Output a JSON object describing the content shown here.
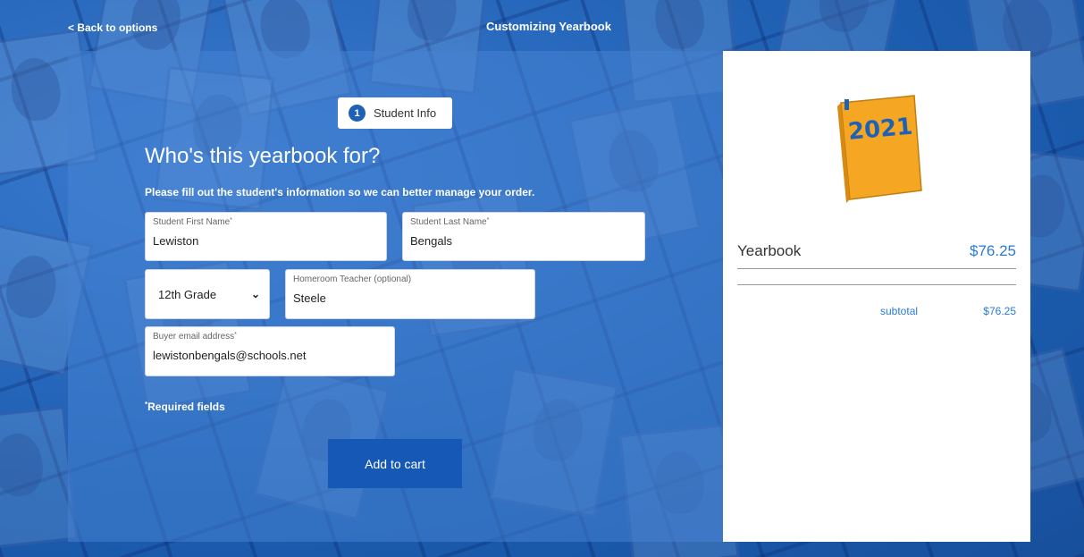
{
  "header": {
    "back_label": "< Back to options",
    "title": "Customizing Yearbook"
  },
  "form": {
    "step_number": "1",
    "step_label": "Student Info",
    "heading": "Who's this yearbook for?",
    "subtext": "Please fill out the student's information so we can better manage your order.",
    "first_name": {
      "label": "Student First Name",
      "value": "Lewiston"
    },
    "last_name": {
      "label": "Student Last Name",
      "value": "Bengals"
    },
    "grade": {
      "value": "12th Grade"
    },
    "homeroom": {
      "label": "Homeroom Teacher (optional)",
      "value": "Steele"
    },
    "email": {
      "label": "Buyer email address",
      "value": "lewistonbengals@schools.net"
    },
    "required_note": "Required fields",
    "submit_label": "Add to cart"
  },
  "summary": {
    "book_year": "2021",
    "item_name": "Yearbook",
    "item_price": "$76.25",
    "subtotal_label": "subtotal",
    "subtotal_value": "$76.25"
  },
  "colors": {
    "brand_blue": "#1f62b5",
    "button_blue": "#1558b5",
    "price_blue": "#2a7ad2",
    "book_orange": "#f5a623"
  }
}
